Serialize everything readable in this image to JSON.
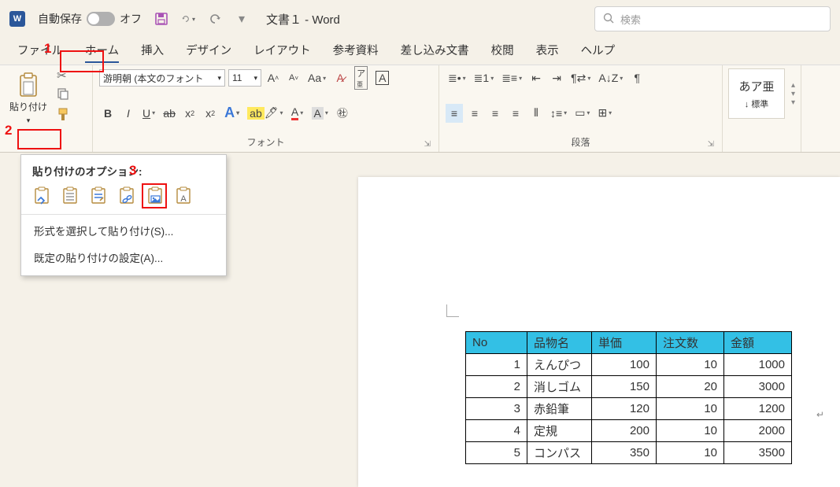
{
  "titlebar": {
    "autosave_label": "自動保存",
    "autosave_state": "オフ",
    "doc_title": "文書１ - Word"
  },
  "search": {
    "placeholder": "検索"
  },
  "menu": {
    "file": "ファイル",
    "home": "ホーム",
    "insert": "挿入",
    "design": "デザイン",
    "layout": "レイアウト",
    "reference": "参考資料",
    "mailings": "差し込み文書",
    "review": "校閲",
    "view": "表示",
    "help": "ヘルプ"
  },
  "ribbon": {
    "clipboard": {
      "paste_label": "貼り付け",
      "group": ""
    },
    "font": {
      "name": "游明朝 (本文のフォント",
      "size": "11",
      "group": "フォント"
    },
    "paragraph": {
      "group": "段落"
    },
    "styles": {
      "sample": "あア亜",
      "name": "↓ 標準",
      "group": ""
    }
  },
  "paste_menu": {
    "title": "貼り付けのオプション:",
    "special": "形式を選択して貼り付け(S)...",
    "default": "既定の貼り付けの設定(A)..."
  },
  "table": {
    "headers": {
      "no": "No",
      "name": "品物名",
      "price": "単価",
      "qty": "注文数",
      "amount": "金額"
    },
    "rows": [
      {
        "no": "1",
        "name": "えんぴつ",
        "price": "100",
        "qty": "10",
        "amount": "1000"
      },
      {
        "no": "2",
        "name": "消しゴム",
        "price": "150",
        "qty": "20",
        "amount": "3000"
      },
      {
        "no": "3",
        "name": "赤鉛筆",
        "price": "120",
        "qty": "10",
        "amount": "1200"
      },
      {
        "no": "4",
        "name": "定規",
        "price": "200",
        "qty": "10",
        "amount": "2000"
      },
      {
        "no": "5",
        "name": "コンパス",
        "price": "350",
        "qty": "10",
        "amount": "3500"
      }
    ]
  },
  "annotations": {
    "one": "1",
    "two": "2",
    "three": "3"
  }
}
